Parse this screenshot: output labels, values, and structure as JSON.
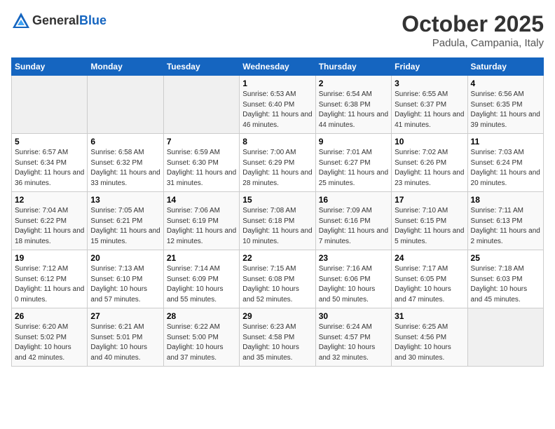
{
  "header": {
    "logo_line1": "General",
    "logo_line2": "Blue",
    "month": "October 2025",
    "location": "Padula, Campania, Italy"
  },
  "days_of_week": [
    "Sunday",
    "Monday",
    "Tuesday",
    "Wednesday",
    "Thursday",
    "Friday",
    "Saturday"
  ],
  "weeks": [
    [
      {
        "day": "",
        "info": ""
      },
      {
        "day": "",
        "info": ""
      },
      {
        "day": "",
        "info": ""
      },
      {
        "day": "1",
        "info": "Sunrise: 6:53 AM\nSunset: 6:40 PM\nDaylight: 11 hours and 46 minutes."
      },
      {
        "day": "2",
        "info": "Sunrise: 6:54 AM\nSunset: 6:38 PM\nDaylight: 11 hours and 44 minutes."
      },
      {
        "day": "3",
        "info": "Sunrise: 6:55 AM\nSunset: 6:37 PM\nDaylight: 11 hours and 41 minutes."
      },
      {
        "day": "4",
        "info": "Sunrise: 6:56 AM\nSunset: 6:35 PM\nDaylight: 11 hours and 39 minutes."
      }
    ],
    [
      {
        "day": "5",
        "info": "Sunrise: 6:57 AM\nSunset: 6:34 PM\nDaylight: 11 hours and 36 minutes."
      },
      {
        "day": "6",
        "info": "Sunrise: 6:58 AM\nSunset: 6:32 PM\nDaylight: 11 hours and 33 minutes."
      },
      {
        "day": "7",
        "info": "Sunrise: 6:59 AM\nSunset: 6:30 PM\nDaylight: 11 hours and 31 minutes."
      },
      {
        "day": "8",
        "info": "Sunrise: 7:00 AM\nSunset: 6:29 PM\nDaylight: 11 hours and 28 minutes."
      },
      {
        "day": "9",
        "info": "Sunrise: 7:01 AM\nSunset: 6:27 PM\nDaylight: 11 hours and 25 minutes."
      },
      {
        "day": "10",
        "info": "Sunrise: 7:02 AM\nSunset: 6:26 PM\nDaylight: 11 hours and 23 minutes."
      },
      {
        "day": "11",
        "info": "Sunrise: 7:03 AM\nSunset: 6:24 PM\nDaylight: 11 hours and 20 minutes."
      }
    ],
    [
      {
        "day": "12",
        "info": "Sunrise: 7:04 AM\nSunset: 6:22 PM\nDaylight: 11 hours and 18 minutes."
      },
      {
        "day": "13",
        "info": "Sunrise: 7:05 AM\nSunset: 6:21 PM\nDaylight: 11 hours and 15 minutes."
      },
      {
        "day": "14",
        "info": "Sunrise: 7:06 AM\nSunset: 6:19 PM\nDaylight: 11 hours and 12 minutes."
      },
      {
        "day": "15",
        "info": "Sunrise: 7:08 AM\nSunset: 6:18 PM\nDaylight: 11 hours and 10 minutes."
      },
      {
        "day": "16",
        "info": "Sunrise: 7:09 AM\nSunset: 6:16 PM\nDaylight: 11 hours and 7 minutes."
      },
      {
        "day": "17",
        "info": "Sunrise: 7:10 AM\nSunset: 6:15 PM\nDaylight: 11 hours and 5 minutes."
      },
      {
        "day": "18",
        "info": "Sunrise: 7:11 AM\nSunset: 6:13 PM\nDaylight: 11 hours and 2 minutes."
      }
    ],
    [
      {
        "day": "19",
        "info": "Sunrise: 7:12 AM\nSunset: 6:12 PM\nDaylight: 11 hours and 0 minutes."
      },
      {
        "day": "20",
        "info": "Sunrise: 7:13 AM\nSunset: 6:10 PM\nDaylight: 10 hours and 57 minutes."
      },
      {
        "day": "21",
        "info": "Sunrise: 7:14 AM\nSunset: 6:09 PM\nDaylight: 10 hours and 55 minutes."
      },
      {
        "day": "22",
        "info": "Sunrise: 7:15 AM\nSunset: 6:08 PM\nDaylight: 10 hours and 52 minutes."
      },
      {
        "day": "23",
        "info": "Sunrise: 7:16 AM\nSunset: 6:06 PM\nDaylight: 10 hours and 50 minutes."
      },
      {
        "day": "24",
        "info": "Sunrise: 7:17 AM\nSunset: 6:05 PM\nDaylight: 10 hours and 47 minutes."
      },
      {
        "day": "25",
        "info": "Sunrise: 7:18 AM\nSunset: 6:03 PM\nDaylight: 10 hours and 45 minutes."
      }
    ],
    [
      {
        "day": "26",
        "info": "Sunrise: 6:20 AM\nSunset: 5:02 PM\nDaylight: 10 hours and 42 minutes."
      },
      {
        "day": "27",
        "info": "Sunrise: 6:21 AM\nSunset: 5:01 PM\nDaylight: 10 hours and 40 minutes."
      },
      {
        "day": "28",
        "info": "Sunrise: 6:22 AM\nSunset: 5:00 PM\nDaylight: 10 hours and 37 minutes."
      },
      {
        "day": "29",
        "info": "Sunrise: 6:23 AM\nSunset: 4:58 PM\nDaylight: 10 hours and 35 minutes."
      },
      {
        "day": "30",
        "info": "Sunrise: 6:24 AM\nSunset: 4:57 PM\nDaylight: 10 hours and 32 minutes."
      },
      {
        "day": "31",
        "info": "Sunrise: 6:25 AM\nSunset: 4:56 PM\nDaylight: 10 hours and 30 minutes."
      },
      {
        "day": "",
        "info": ""
      }
    ]
  ]
}
